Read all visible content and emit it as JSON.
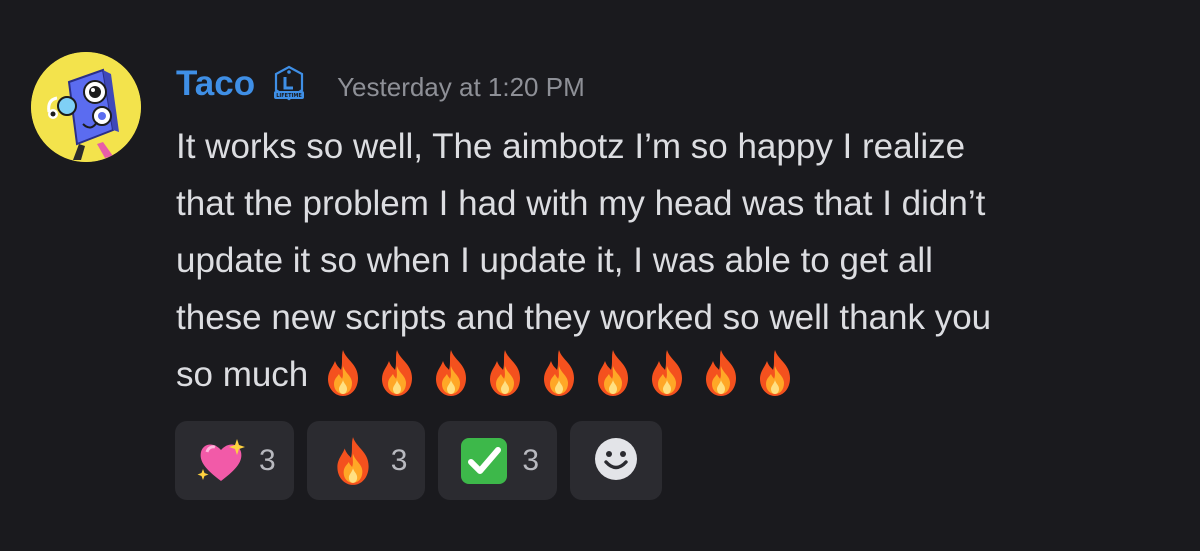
{
  "message": {
    "author": "Taco",
    "role_badge": "LIFETIME",
    "timestamp": "Yesterday at 1:20 PM",
    "content_lines": [
      "It works so well, The aimbotz I’m so happy I realize",
      "that the problem I had with my head was that I didn’t",
      "update it so when I update it, I was able to get all",
      "these new scripts and they worked so well thank you",
      "so much"
    ],
    "trailing_emoji": "fire-emoji",
    "trailing_emoji_count": 9
  },
  "reactions": [
    {
      "emoji": "sparkling-heart-emoji",
      "count": "3"
    },
    {
      "emoji": "fire-emoji",
      "count": "3"
    },
    {
      "emoji": "check-mark-button-emoji",
      "count": "3"
    }
  ],
  "colors": {
    "background": "#1a1a1e",
    "username": "#3f8fe6",
    "text": "#dcdde1",
    "timestamp": "#8e9097",
    "reaction_bg": "#2b2b30"
  }
}
